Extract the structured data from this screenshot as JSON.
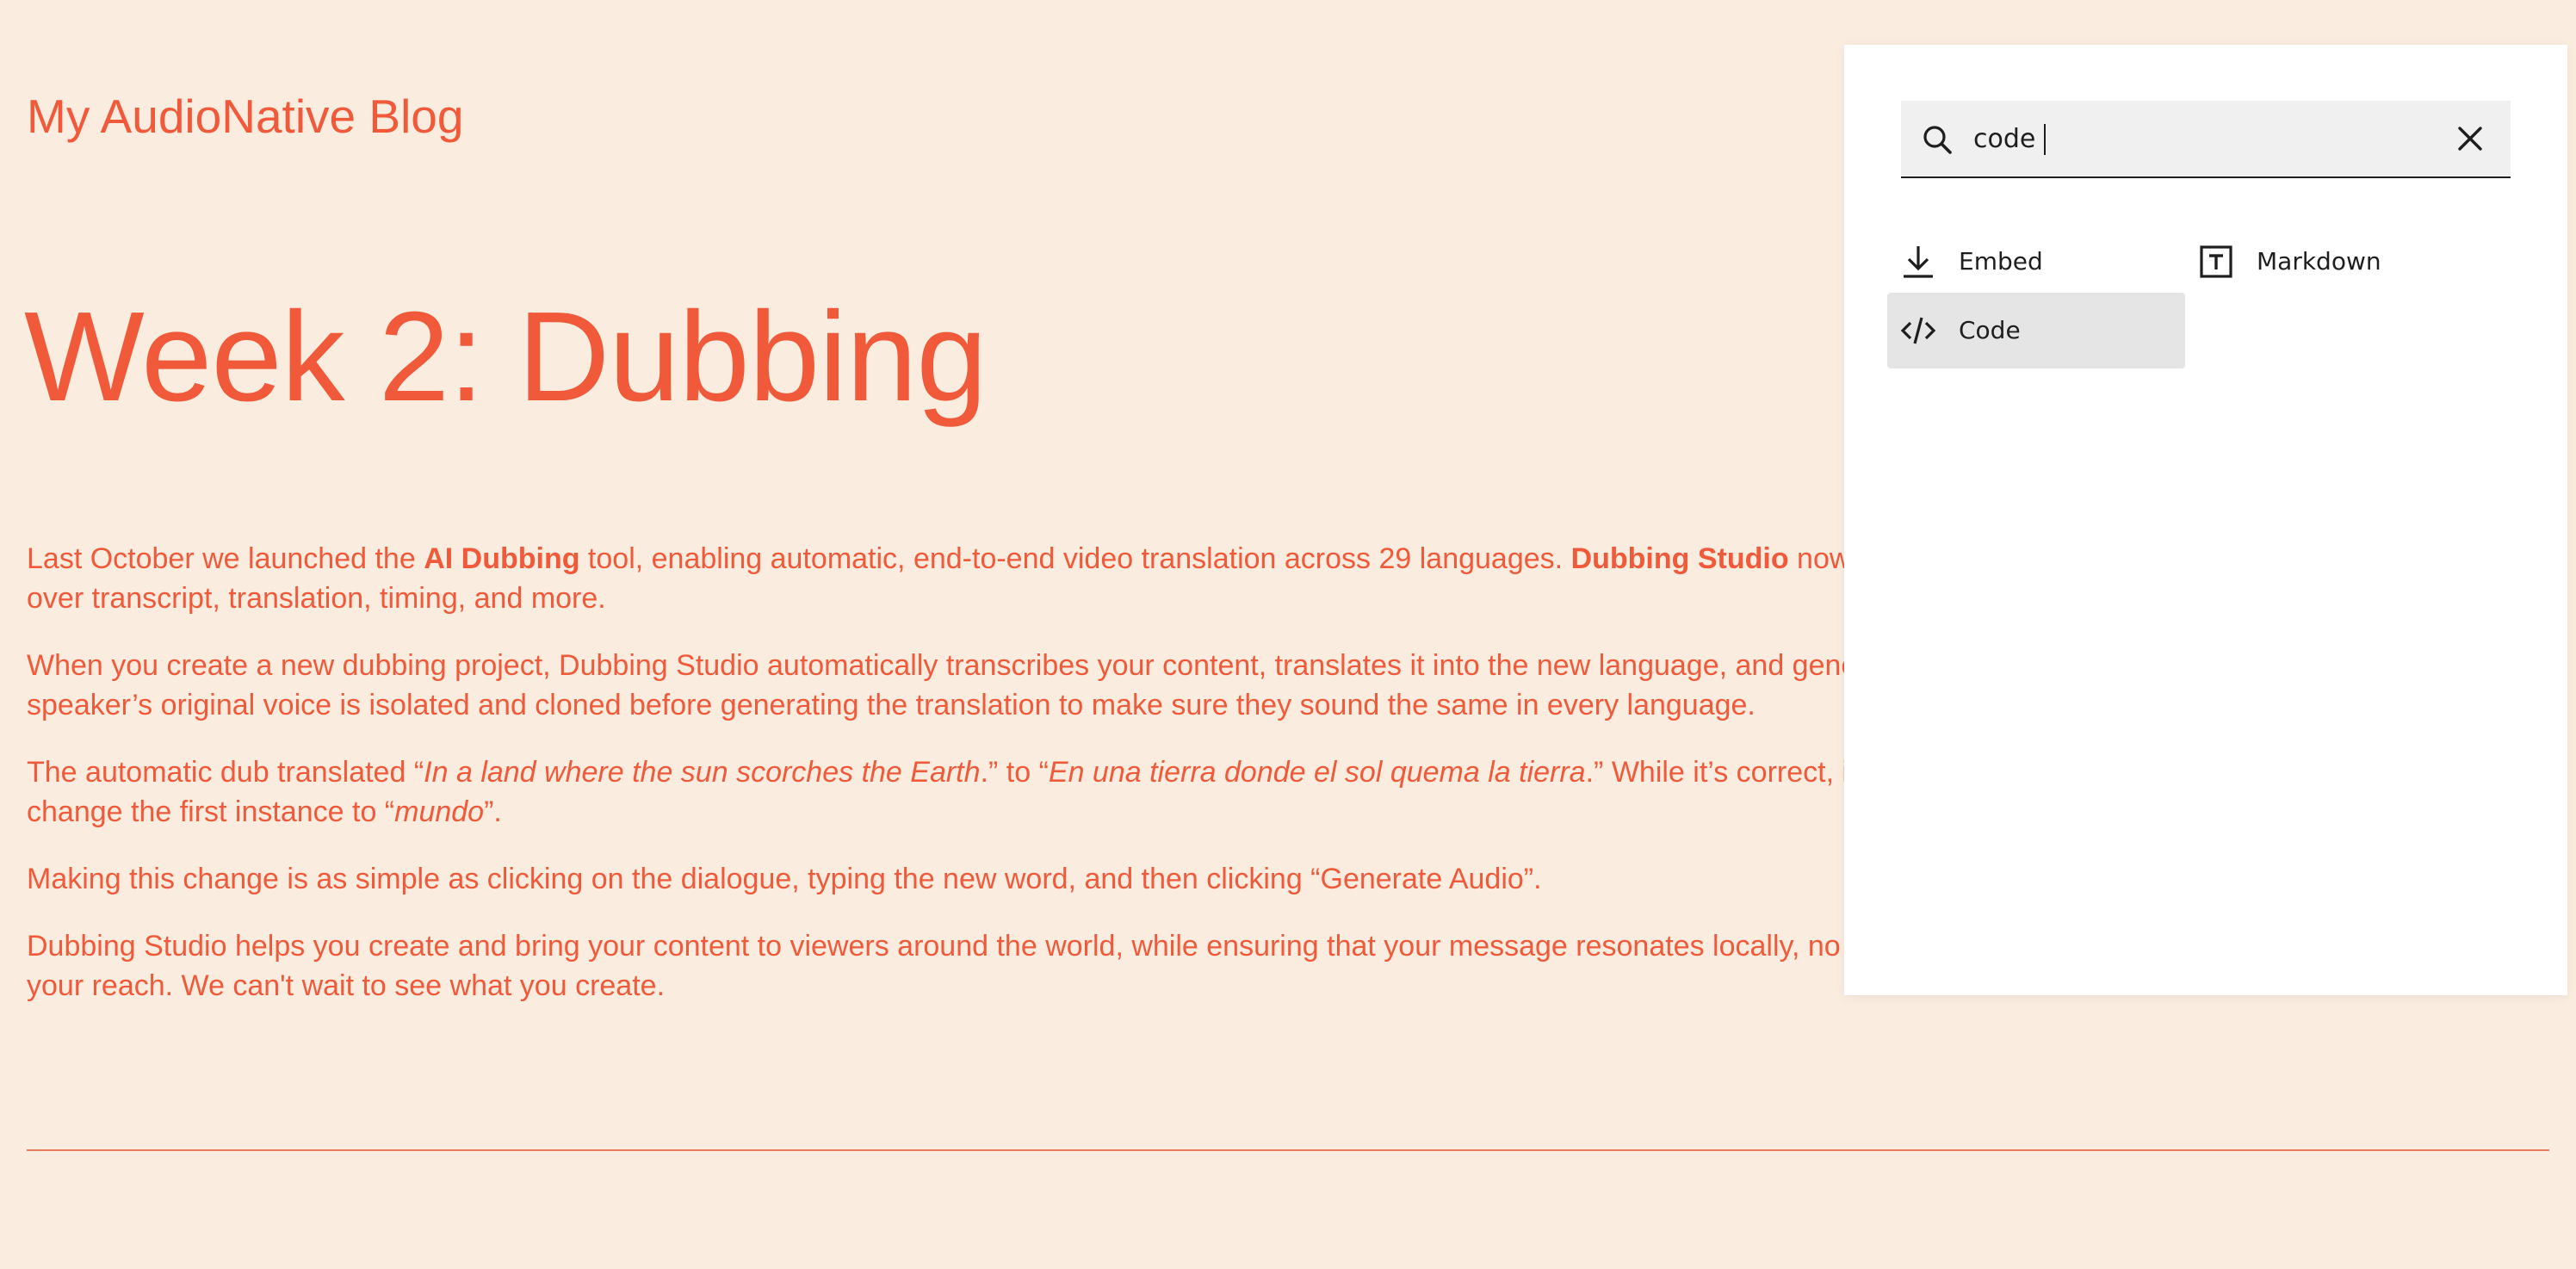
{
  "blog": {
    "site_title": "My AudioNative Blog",
    "post_title": "Week 2: Dubbing",
    "paragraphs": {
      "p1": {
        "l1_a": "Last October we launched the ",
        "l1_b": "AI Dubbing",
        "l1_c": " tool, enabling automatic, end-to-end video translation across 29 languages. ",
        "l1_d": "Dubbing Studio",
        "l1_e": " now le",
        "l2": "over transcript, translation, timing, and more."
      },
      "p2": {
        "l1": "When you create a new dubbing project, Dubbing Studio automatically transcribes your content, translates it into the new language, and gene",
        "l2": "speaker’s original voice is isolated and cloned before generating the translation to make sure they sound the same in every language."
      },
      "p3": {
        "l1_a": "The automatic dub translated “",
        "l1_b": "In a land where the sun scorches the Earth",
        "l1_c": ".” to “",
        "l1_d": "En una tierra donde el sol quema la tierra",
        "l1_e": ".” While it’s correct, it’s a",
        "l2_a": "change the first instance to “",
        "l2_b": "mundo",
        "l2_c": "”."
      },
      "p4": {
        "l1": "Making this change is as simple as clicking on the dialogue, typing the new word, and then clicking “Generate Audio”."
      },
      "p5": {
        "l1": "Dubbing Studio helps you create and bring your content to viewers around the world, while ensuring that your message resonates locally, no r",
        "l2": "your reach. We can't wait to see what you create."
      }
    },
    "accent_color": "#f05a3a",
    "background_color": "#faeddf"
  },
  "inserter": {
    "search_value": "code",
    "search_icon": "search-icon",
    "close_icon": "close-icon",
    "results": [
      {
        "label": "Embed",
        "icon": "download-icon",
        "selected": false
      },
      {
        "label": "Markdown",
        "icon": "markdown-icon",
        "selected": false
      },
      {
        "label": "Code",
        "icon": "code-icon",
        "selected": true
      }
    ]
  }
}
